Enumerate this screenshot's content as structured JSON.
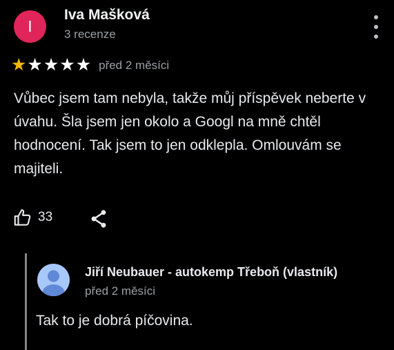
{
  "review": {
    "avatar_initial": "I",
    "avatar_color": "#e0255a",
    "author_name": "Iva Mašková",
    "review_count": "3 recenze",
    "rating": 1,
    "rating_max": 5,
    "date": "před 2 měsíci",
    "text": "Vůbec jsem tam nebyla, takže můj příspěvek neberte v úvahu. Šla jsem jen okolo a Googl na mně chtěl hodnocení. Tak jsem to jen odklepla. Omlouvám se majiteli.",
    "likes": "33",
    "star_color": "#f3b80b"
  },
  "reply": {
    "owner_name": "Jiří Neubauer - autokemp Třeboň (vlastník)",
    "date": "před 2 měsíci",
    "text": "Tak to je dobrá píčovina.",
    "avatar_color": "#a8c7fa"
  },
  "icons": {
    "more": "more-vert-icon",
    "like": "thumb-up-icon",
    "share": "share-icon",
    "owner_avatar": "person-icon"
  }
}
